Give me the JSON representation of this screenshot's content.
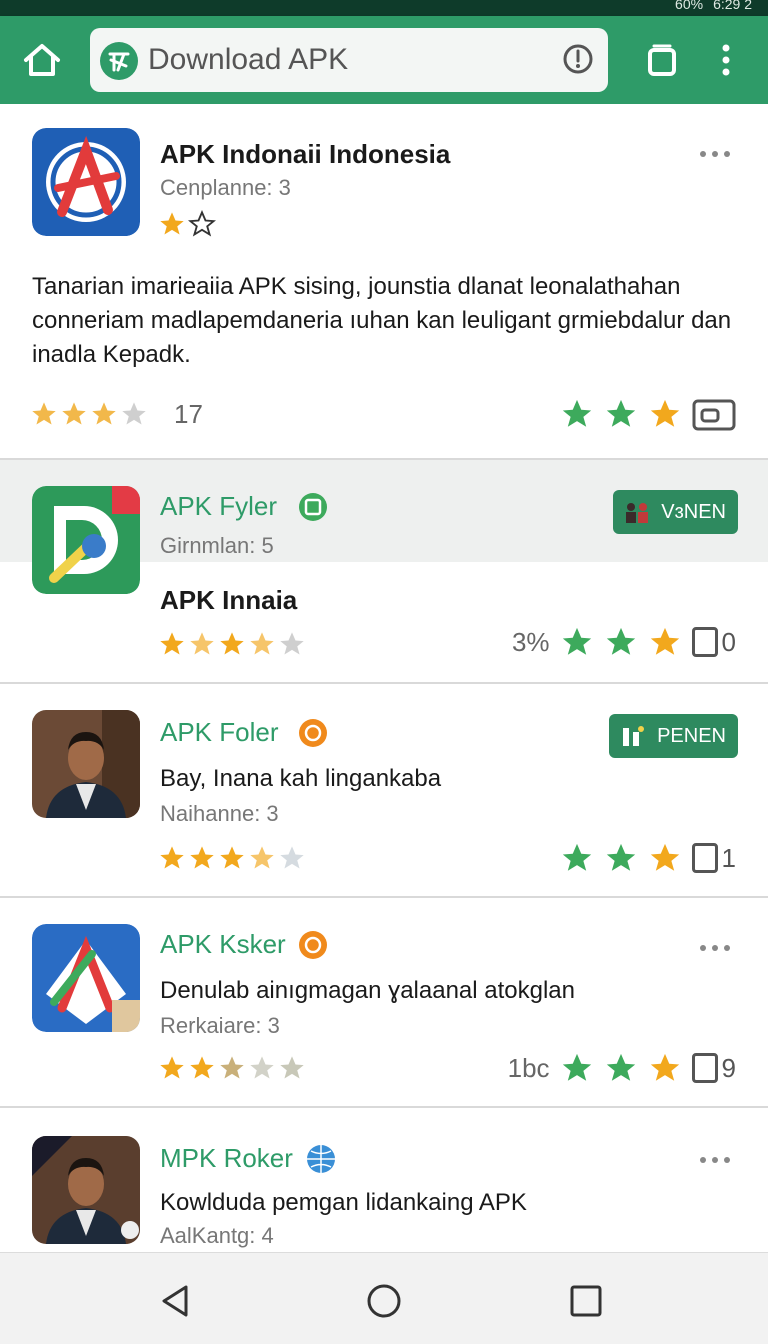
{
  "status_bar": {
    "time": "6:29 2",
    "battery": "60%"
  },
  "toolbar": {
    "url_text": "Download APK",
    "icons": [
      "home-icon",
      "site-logo-icon",
      "info-icon",
      "tabs-icon",
      "overflow-menu-icon"
    ]
  },
  "apps": [
    {
      "title": "APK Indonaii Indonesia",
      "subtitle": "Cenplanne: 3",
      "description": "Tanarian imarieaiia APK sising, jounstia dlanat leonalathahan conneriam madlapemdaneria ıuhan kan leuligant grmiebdalur dan inadla Kepadk.",
      "meta_left": "17",
      "count": ""
    },
    {
      "title": "APK Fyler",
      "subtitle": "Girnmlan: 5",
      "description": "APK Innaia",
      "badge": "VɜNEN",
      "meta": "3%",
      "count": "0"
    },
    {
      "title": "APK Foler",
      "subtitle": "Naihanne: 3",
      "description": "Bay, Inana  kah lingankaba",
      "badge": "PENEN",
      "count": "1"
    },
    {
      "title": "APK Ksker",
      "subtitle": "Rerkaiare: 3",
      "description": "Denulab ainıgmagan ɣalaanal atokglan",
      "meta": "1bc",
      "count": "9"
    },
    {
      "title": "MPK Roker",
      "subtitle": "AalKantg: 4",
      "description": "Kowlduda pemgan lidankaing APK"
    }
  ],
  "colors": {
    "brand_green": "#2e9b68",
    "star_gold": "#f2a81d",
    "star_green": "#3daa5c"
  },
  "nav": {
    "icons": [
      "back-icon",
      "home-circle-icon",
      "recents-icon"
    ]
  }
}
